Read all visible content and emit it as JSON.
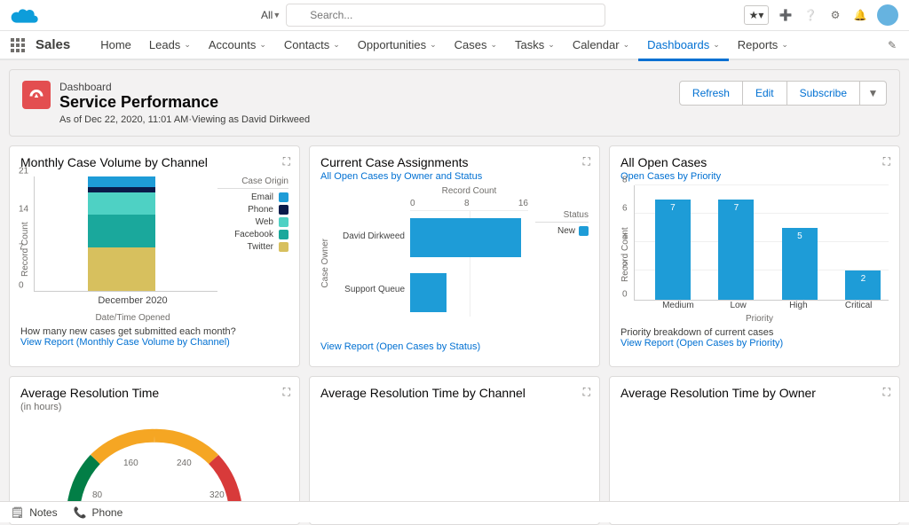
{
  "header": {
    "search_scope": "All",
    "search_placeholder": "Search..."
  },
  "nav": {
    "app_name": "Sales",
    "items": [
      "Home",
      "Leads",
      "Accounts",
      "Contacts",
      "Opportunities",
      "Cases",
      "Tasks",
      "Calendar",
      "Dashboards",
      "Reports"
    ],
    "active": "Dashboards"
  },
  "page": {
    "type": "Dashboard",
    "title": "Service Performance",
    "sub": "As of Dec 22, 2020, 11:01 AM·Viewing as David Dirkweed",
    "actions": {
      "refresh": "Refresh",
      "edit": "Edit",
      "subscribe": "Subscribe"
    }
  },
  "cards": {
    "c1": {
      "title": "Monthly Case Volume by Channel",
      "footer": "How many new cases get submitted each month?",
      "link": "View Report (Monthly Case Volume by Channel)",
      "ylabel": "Record Count",
      "xcat": "December 2020",
      "xlabel": "Date/Time Opened",
      "legend_title": "Case Origin",
      "legend": [
        "Email",
        "Phone",
        "Web",
        "Facebook",
        "Twitter"
      ]
    },
    "c2": {
      "title": "Current Case Assignments",
      "sub": "All Open Cases by Owner and Status",
      "link": "View Report (Open Cases by Status)",
      "owners": [
        "David Dirkweed",
        "Support Queue"
      ],
      "top_label": "Record Count",
      "ylabel": "Case Owner",
      "legend_title": "Status",
      "legend_item": "New",
      "ticks": [
        "0",
        "8",
        "16"
      ]
    },
    "c3": {
      "title": "All Open Cases",
      "sub": "Open Cases by Priority",
      "footer": "Priority breakdown of current cases",
      "link": "View Report (Open Cases by Priority)",
      "ylabel": "Record Count",
      "xlabel": "Priority",
      "cats": [
        "Medium",
        "Low",
        "High",
        "Critical"
      ]
    },
    "c4": {
      "title": "Average Resolution Time",
      "sub": "(in hours)"
    },
    "c5": {
      "title": "Average Resolution Time by Channel"
    },
    "c6": {
      "title": "Average Resolution Time by Owner"
    }
  },
  "bottom": {
    "notes": "Notes",
    "phone": "Phone"
  },
  "chart_data": [
    {
      "id": "monthly_case_volume",
      "type": "bar",
      "stacked": true,
      "categories": [
        "December 2020"
      ],
      "series": [
        {
          "name": "Twitter",
          "values": [
            8
          ],
          "color": "#d7c05e"
        },
        {
          "name": "Facebook",
          "values": [
            6
          ],
          "color": "#1aa89c"
        },
        {
          "name": "Web",
          "values": [
            4
          ],
          "color": "#4ed1c4"
        },
        {
          "name": "Phone",
          "values": [
            1
          ],
          "color": "#0a1a4a"
        },
        {
          "name": "Email",
          "values": [
            2
          ],
          "color": "#1e9cd7"
        }
      ],
      "ylabel": "Record Count",
      "xlabel": "Date/Time Opened",
      "ylim": [
        0,
        21
      ],
      "yticks": [
        0,
        7,
        14,
        21
      ],
      "legend_title": "Case Origin"
    },
    {
      "id": "current_case_assignments",
      "type": "bar",
      "orientation": "horizontal",
      "categories": [
        "David Dirkweed",
        "Support Queue"
      ],
      "series": [
        {
          "name": "New",
          "values": [
            15,
            5
          ],
          "color": "#1e9cd7"
        }
      ],
      "xlabel": "Record Count",
      "ylabel": "Case Owner",
      "xlim": [
        0,
        16
      ],
      "xticks": [
        0,
        8,
        16
      ],
      "legend_title": "Status"
    },
    {
      "id": "open_cases_by_priority",
      "type": "bar",
      "categories": [
        "Medium",
        "Low",
        "High",
        "Critical"
      ],
      "values": [
        7,
        7,
        5,
        2
      ],
      "ylabel": "Record Count",
      "xlabel": "Priority",
      "ylim": [
        0,
        8
      ],
      "yticks": [
        0,
        2,
        4,
        6,
        8
      ],
      "color": "#1e9cd7"
    },
    {
      "id": "avg_resolution_time",
      "type": "gauge",
      "title": "Average Resolution Time",
      "unit": "hours",
      "ticks": [
        80,
        160,
        240,
        320
      ],
      "segments": [
        {
          "color": "#027e46"
        },
        {
          "color": "#f5a623"
        },
        {
          "color": "#f5a623"
        },
        {
          "color": "#d83a3a"
        }
      ]
    }
  ]
}
